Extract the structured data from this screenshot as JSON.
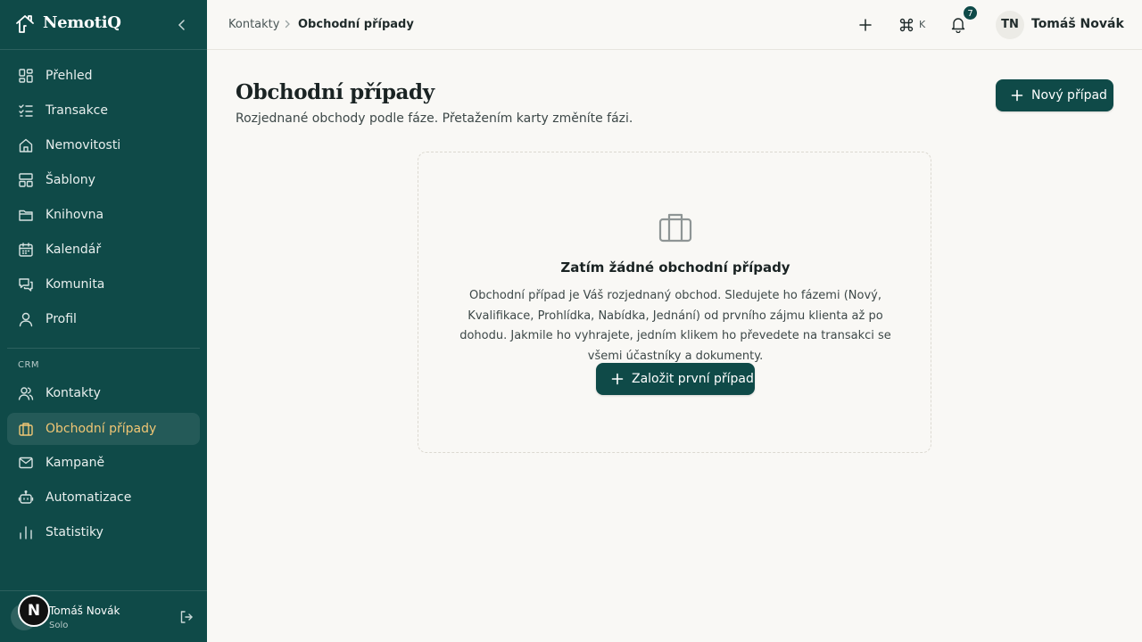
{
  "brand": {
    "name": "NemotiQ"
  },
  "sidebar": {
    "items": [
      {
        "label": "Přehled",
        "icon": "grid-icon"
      },
      {
        "label": "Transakce",
        "icon": "checklist-icon"
      },
      {
        "label": "Nemovitosti",
        "icon": "home-icon"
      },
      {
        "label": "Šablony",
        "icon": "template-icon"
      },
      {
        "label": "Knihovna",
        "icon": "folder-icon"
      },
      {
        "label": "Kalendář",
        "icon": "calendar-icon"
      },
      {
        "label": "Komunita",
        "icon": "chat-icon"
      },
      {
        "label": "Profil",
        "icon": "user-icon"
      }
    ],
    "section_label": "CRM",
    "crm_items": [
      {
        "label": "Kontakty",
        "icon": "users-icon"
      },
      {
        "label": "Obchodní případy",
        "icon": "briefcase-icon",
        "active": true
      },
      {
        "label": "Kampaně",
        "icon": "mail-icon"
      },
      {
        "label": "Automatizace",
        "icon": "bot-icon"
      },
      {
        "label": "Statistiky",
        "icon": "bar-chart-icon"
      }
    ],
    "footer": {
      "avatar_letter": "N",
      "name": "Tomáš Novák",
      "plan": "Solo"
    }
  },
  "topbar": {
    "breadcrumb": [
      "Kontakty",
      "Obchodní případy"
    ],
    "shortcut_key": "K",
    "notification_count": "7",
    "user_initials": "TN",
    "user_name": "Tomáš Novák"
  },
  "main": {
    "title": "Obchodní případy",
    "subtitle": "Rozjednané obchody podle fáze. Přetažením karty změníte fázi.",
    "new_button": "Nový případ",
    "empty": {
      "title": "Zatím žádné obchodní případy",
      "text": "Obchodní případ je Váš rozjednaný obchod. Sledujete ho fázemi (Nový, Kvalifikace, Prohlídka, Nabídka, Jednání) od prvního zájmu klienta až po dohodu. Jakmile ho vyhrajete, jedním klikem ho převedete na transakci se všemi účastníky a dokumenty.",
      "button": "Založit první případ"
    }
  },
  "colors": {
    "sidebar_bg": "#0f4a48",
    "accent": "#f0c674",
    "background": "#f9f8f5"
  }
}
